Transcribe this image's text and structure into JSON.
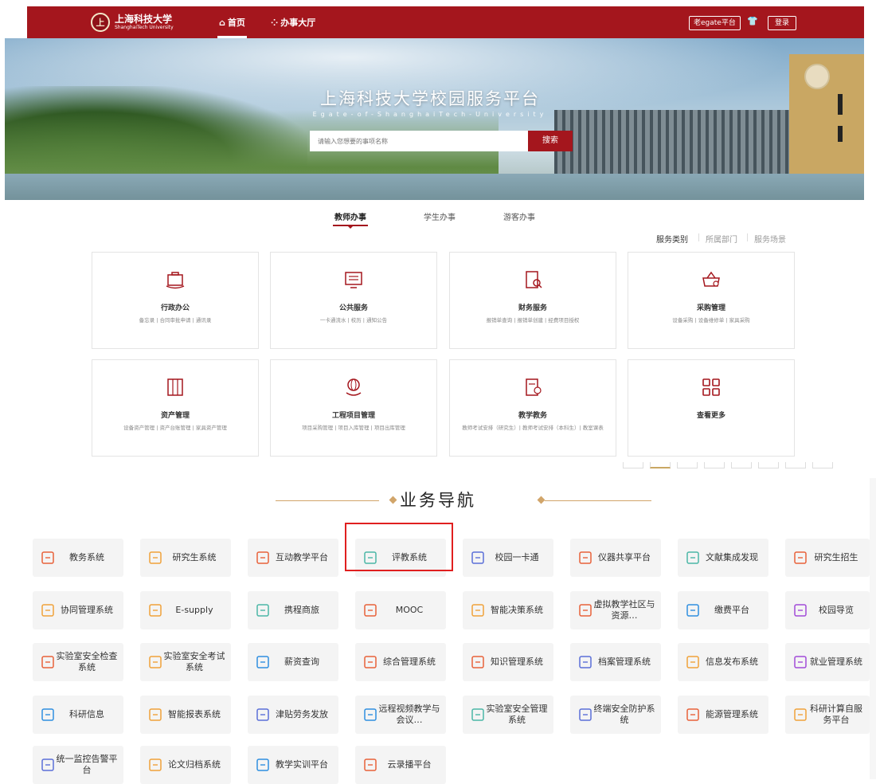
{
  "header": {
    "logo_cn": "上海科技大学",
    "logo_en": "ShanghaiTech University",
    "nav": [
      {
        "label": "首页",
        "icon": "building-icon"
      },
      {
        "label": "办事大厅",
        "icon": "grid-icon"
      }
    ],
    "egate_label": "老egate平台",
    "login_label": "登录"
  },
  "banner": {
    "title": "上海科技大学校园服务平台",
    "subtitle": "Egate-of-ShanghaiTech-University",
    "search_placeholder": "请输入您想要的事项名称",
    "search_button": "搜索"
  },
  "tabs": [
    "教师办事",
    "学生办事",
    "游客办事"
  ],
  "filters": [
    "服务类别",
    "所属部门",
    "服务场景"
  ],
  "categories": [
    {
      "title": "行政办公",
      "desc": "备忘录 | 合同审批申请 | 通讯录"
    },
    {
      "title": "公共服务",
      "desc": "一卡通流水 | 校历 | 通知公告"
    },
    {
      "title": "财务服务",
      "desc": "报销单查询 | 报销单创建 | 经费项目授权"
    },
    {
      "title": "采购管理",
      "desc": "设备采购 | 设备维修单 | 家具采购"
    },
    {
      "title": "资产管理",
      "desc": "设备资产管理 | 资产台账管理 | 家具资产管理"
    },
    {
      "title": "工程项目管理",
      "desc": "项目采购管理 | 项目入库管理 | 项目出库管理"
    },
    {
      "title": "教学教务",
      "desc": "教师考试安排（研究生）| 教师考试安排（本科生）| 教室课表"
    },
    {
      "title": "查看更多",
      "desc": ""
    }
  ],
  "section_title": "业务导航",
  "services": [
    {
      "label": "教务系统",
      "icon": "chart-icon",
      "color": "#e8613a"
    },
    {
      "label": "研究生系统",
      "icon": "book-icon",
      "color": "#f0a23a"
    },
    {
      "label": "互动教学平台",
      "icon": "screen-icon",
      "color": "#e8613a"
    },
    {
      "label": "评教系统",
      "icon": "evaluate-icon",
      "color": "#4bb7a6"
    },
    {
      "label": "校园一卡通",
      "icon": "card-icon",
      "color": "#5b6fd8"
    },
    {
      "label": "仪器共享平台",
      "icon": "instrument-icon",
      "color": "#e8613a"
    },
    {
      "label": "文献集成发现",
      "icon": "document-icon",
      "color": "#4bb7a6"
    },
    {
      "label": "研究生招生",
      "icon": "admission-icon",
      "color": "#e8613a"
    },
    {
      "label": "协同管理系统",
      "icon": "collab-icon",
      "color": "#f0a23a"
    },
    {
      "label": "E-supply",
      "icon": "supply-icon",
      "color": "#f0a23a"
    },
    {
      "label": "携程商旅",
      "icon": "plane-icon",
      "color": "#4bb7a6"
    },
    {
      "label": "MOOC",
      "icon": "monitor-icon",
      "color": "#e8613a"
    },
    {
      "label": "智能决策系统",
      "icon": "decision-icon",
      "color": "#f0a23a"
    },
    {
      "label": "虚拟教学社区与资源…",
      "icon": "server-icon",
      "color": "#e8613a"
    },
    {
      "label": "缴费平台",
      "icon": "payment-icon",
      "color": "#2f8fe0"
    },
    {
      "label": "校园导览",
      "icon": "location-icon",
      "color": "#a24bd8"
    },
    {
      "label": "实验室安全检查系统",
      "icon": "home-icon",
      "color": "#e8613a"
    },
    {
      "label": "实验室安全考试系统",
      "icon": "exam-icon",
      "color": "#f0a23a"
    },
    {
      "label": "薪资查询",
      "icon": "search-icon",
      "color": "#2f8fe0"
    },
    {
      "label": "综合管理系统",
      "icon": "manage-icon",
      "color": "#e8613a"
    },
    {
      "label": "知识管理系统",
      "icon": "knowledge-icon",
      "color": "#e8613a"
    },
    {
      "label": "档案管理系统",
      "icon": "archive-icon",
      "color": "#5b6fd8"
    },
    {
      "label": "信息发布系统",
      "icon": "publish-icon",
      "color": "#f0a23a"
    },
    {
      "label": "就业管理系统",
      "icon": "briefcase-icon",
      "color": "#a24bd8"
    },
    {
      "label": "科研信息",
      "icon": "research-icon",
      "color": "#2f8fe0"
    },
    {
      "label": "智能报表系统",
      "icon": "report-icon",
      "color": "#f0a23a"
    },
    {
      "label": "津贴劳务发放",
      "icon": "money-icon",
      "color": "#5b6fd8"
    },
    {
      "label": "远程视频教学与会议…",
      "icon": "video-icon",
      "color": "#2f8fe0"
    },
    {
      "label": "实验室安全管理系统",
      "icon": "lab-icon",
      "color": "#4bb7a6"
    },
    {
      "label": "终端安全防护系统",
      "icon": "shield-icon",
      "color": "#5b6fd8"
    },
    {
      "label": "能源管理系统",
      "icon": "energy-icon",
      "color": "#e8613a"
    },
    {
      "label": "科研计算自服务平台",
      "icon": "flask-icon",
      "color": "#f0a23a"
    },
    {
      "label": "统一监控告警平台",
      "icon": "monitor-alert-icon",
      "color": "#5b6fd8"
    },
    {
      "label": "论文归档系统",
      "icon": "paper-icon",
      "color": "#f0a23a"
    },
    {
      "label": "教学实训平台",
      "icon": "training-icon",
      "color": "#2f8fe0"
    },
    {
      "label": "云录播平台",
      "icon": "cloud-icon",
      "color": "#e8613a"
    }
  ],
  "colors": {
    "brand": "#a4161d",
    "accent": "#d1a56a",
    "highlight": "#e01f1f"
  }
}
